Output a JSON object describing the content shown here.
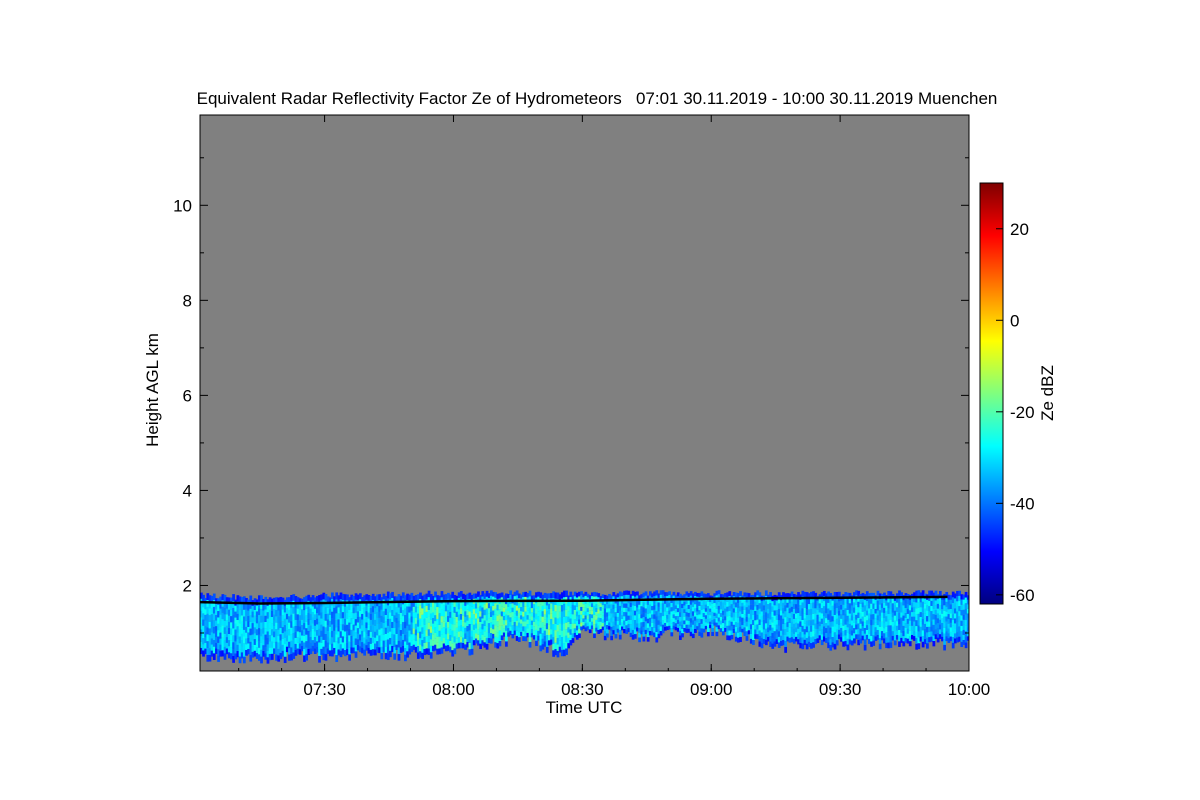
{
  "chart_data": {
    "type": "heatmap",
    "title": "Equivalent Radar Reflectivity Factor Ze of Hydrometeors   07:01 30.11.2019 - 10:00 30.11.2019 Muenchen",
    "xlabel": "Time UTC",
    "ylabel": "Height AGL km",
    "xlim": [
      "07:01",
      "10:00"
    ],
    "ylim": [
      0.2,
      11.9
    ],
    "xticks": [
      "07:30",
      "08:00",
      "08:30",
      "09:00",
      "09:30",
      "10:00"
    ],
    "yticks": [
      2,
      4,
      6,
      8,
      10
    ],
    "background_color": "#808080",
    "colorbar": {
      "label": "Ze dBZ",
      "range": [
        -62,
        30
      ],
      "ticks": [
        20,
        0,
        -20,
        -40,
        -60
      ],
      "colormap": [
        "#00007f",
        "#0000ff",
        "#007fff",
        "#00ffff",
        "#7fff7f",
        "#ffff00",
        "#ff7f00",
        "#ff0000",
        "#7f0000"
      ]
    },
    "cloud_layer": {
      "description_values": "echo present from surface to about 1.8-1.9 km throughout the period, mostly -45 to -25 dBZ, locally up to about -15 dBZ",
      "top_km": [
        {
          "t": "07:01",
          "h": 1.85
        },
        {
          "t": "07:15",
          "h": 1.8
        },
        {
          "t": "07:30",
          "h": 1.85
        },
        {
          "t": "08:00",
          "h": 1.9
        },
        {
          "t": "08:30",
          "h": 1.9
        },
        {
          "t": "09:00",
          "h": 1.9
        },
        {
          "t": "09:30",
          "h": 1.9
        },
        {
          "t": "10:00",
          "h": 1.9
        }
      ],
      "base_km": [
        {
          "t": "07:01",
          "h": 0.45
        },
        {
          "t": "07:30",
          "h": 0.5
        },
        {
          "t": "08:00",
          "h": 0.55
        },
        {
          "t": "08:15",
          "h": 0.9
        },
        {
          "t": "08:25",
          "h": 0.55
        },
        {
          "t": "08:30",
          "h": 1.0
        },
        {
          "t": "08:45",
          "h": 0.9
        },
        {
          "t": "09:00",
          "h": 1.05
        },
        {
          "t": "09:15",
          "h": 0.7
        },
        {
          "t": "09:30",
          "h": 0.75
        },
        {
          "t": "10:00",
          "h": 0.75
        }
      ]
    },
    "cloud_top_line_km": [
      {
        "t": "07:01",
        "h": 1.65
      },
      {
        "t": "07:15",
        "h": 1.62
      },
      {
        "t": "07:30",
        "h": 1.63
      },
      {
        "t": "08:00",
        "h": 1.67
      },
      {
        "t": "08:30",
        "h": 1.68
      },
      {
        "t": "09:00",
        "h": 1.72
      },
      {
        "t": "09:30",
        "h": 1.74
      },
      {
        "t": "09:55",
        "h": 1.76
      }
    ]
  }
}
